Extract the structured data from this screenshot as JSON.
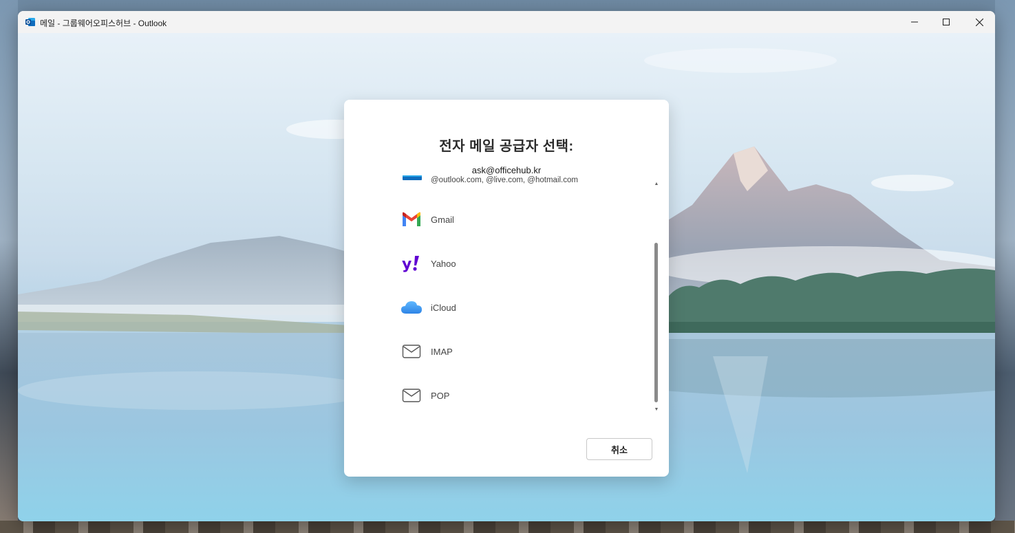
{
  "window": {
    "title": "메일 - 그룹웨어오피스허브 - Outlook",
    "icons": {
      "app": "outlook-icon",
      "minimize": "minimize-icon",
      "maximize": "maximize-icon",
      "close": "close-icon"
    }
  },
  "dialog": {
    "title": "전자 메일 공급자 선택:",
    "account_email": "ask@officehub.kr",
    "providers": [
      {
        "label": "@outlook.com, @live.com, @hotmail.com",
        "icon": "outlook-icon"
      },
      {
        "label": "Gmail",
        "icon": "gmail-icon"
      },
      {
        "label": "Yahoo",
        "icon": "yahoo-icon"
      },
      {
        "label": "iCloud",
        "icon": "icloud-icon"
      },
      {
        "label": "IMAP",
        "icon": "envelope-icon"
      },
      {
        "label": "POP",
        "icon": "envelope-icon"
      }
    ],
    "cancel_label": "취소"
  },
  "colors": {
    "outlook_blue": "#0f6cbd",
    "yahoo_purple": "#6001d2",
    "icloud_blue": "#3e9bf0"
  }
}
